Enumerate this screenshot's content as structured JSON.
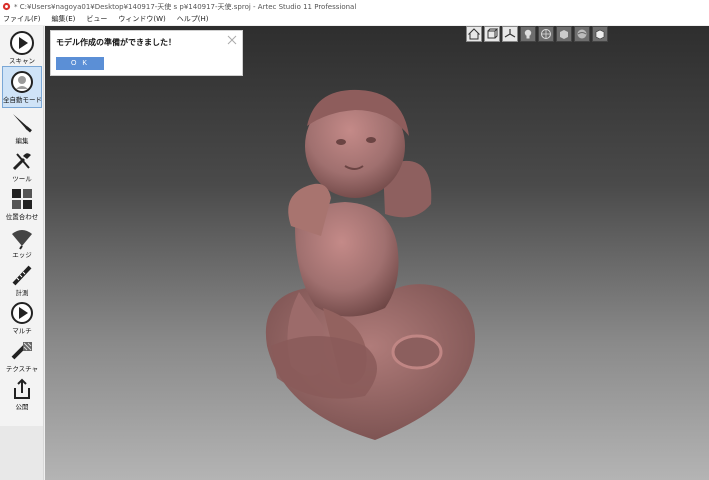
{
  "window": {
    "title": "* C:¥Users¥nagoya01¥Desktop¥140917-天使 s p¥140917-天使.sproj - Artec Studio 11 Professional"
  },
  "menu": {
    "items": [
      "ファイル(F)",
      "編集(E)",
      "ビュー",
      "ウィンドウ(W)",
      "ヘルプ(H)"
    ]
  },
  "toolbar": {
    "items": [
      {
        "label": "スキャン",
        "icon": "play-icon"
      },
      {
        "label": "全自動モード",
        "icon": "auto-mode-icon"
      },
      {
        "label": "編集",
        "icon": "edit-knife-icon"
      },
      {
        "label": "ツール",
        "icon": "tools-icon"
      },
      {
        "label": "位置合わせ",
        "icon": "align-icon"
      },
      {
        "label": "エッジ",
        "icon": "eraser-icon"
      },
      {
        "label": "計測",
        "icon": "measure-icon"
      },
      {
        "label": "マルチ",
        "icon": "multi-icon"
      },
      {
        "label": "テクスチャ",
        "icon": "texture-icon"
      },
      {
        "label": "公開",
        "icon": "export-icon"
      }
    ],
    "active_index": 1
  },
  "notice": {
    "message": "モデル作成の準備ができました！",
    "ok_label": "O K"
  },
  "view_buttons": [
    "home-view-icon",
    "perspective-view-icon",
    "axes-icon",
    "light-icon",
    "wireframe-icon",
    "solid-icon",
    "texture-view-icon",
    "box-icon"
  ],
  "colors": {
    "model": "#a0706f",
    "accent": "#5b8fd6",
    "active_tool": "#cfe3f7"
  }
}
